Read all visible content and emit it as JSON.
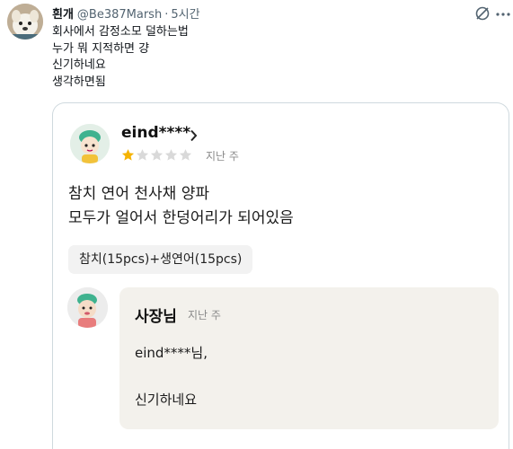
{
  "tweet": {
    "display_name": "흰개",
    "handle": "@Be387Marsh",
    "separator": "·",
    "time": "5시간",
    "lines": [
      "회사에서 감정소모 덜하는법",
      "누가 뭐 지적하면 걍",
      "신기하네요",
      "생각하면됨"
    ]
  },
  "icons": {
    "author_avatar": "white-dog-avatar",
    "grok": "grok-icon",
    "more": "more-icon"
  },
  "review": {
    "reviewer": "eind****",
    "rating": 1,
    "rating_max": 5,
    "date": "지난 주",
    "body": [
      "참치 연어 천사채 양파",
      "모두가 얼어서 한덩어리가 되어있음"
    ],
    "option": "참치(15pcs)+생연어(15pcs)"
  },
  "reply": {
    "author": "사장님",
    "date": "지난 주",
    "greeting": "eind****님,",
    "message": "신기하네요"
  },
  "colors": {
    "star_filled": "#f5b301",
    "star_empty": "#d9d9d9",
    "reply_bg": "#f3f1ec",
    "muted_text": "#536471"
  }
}
